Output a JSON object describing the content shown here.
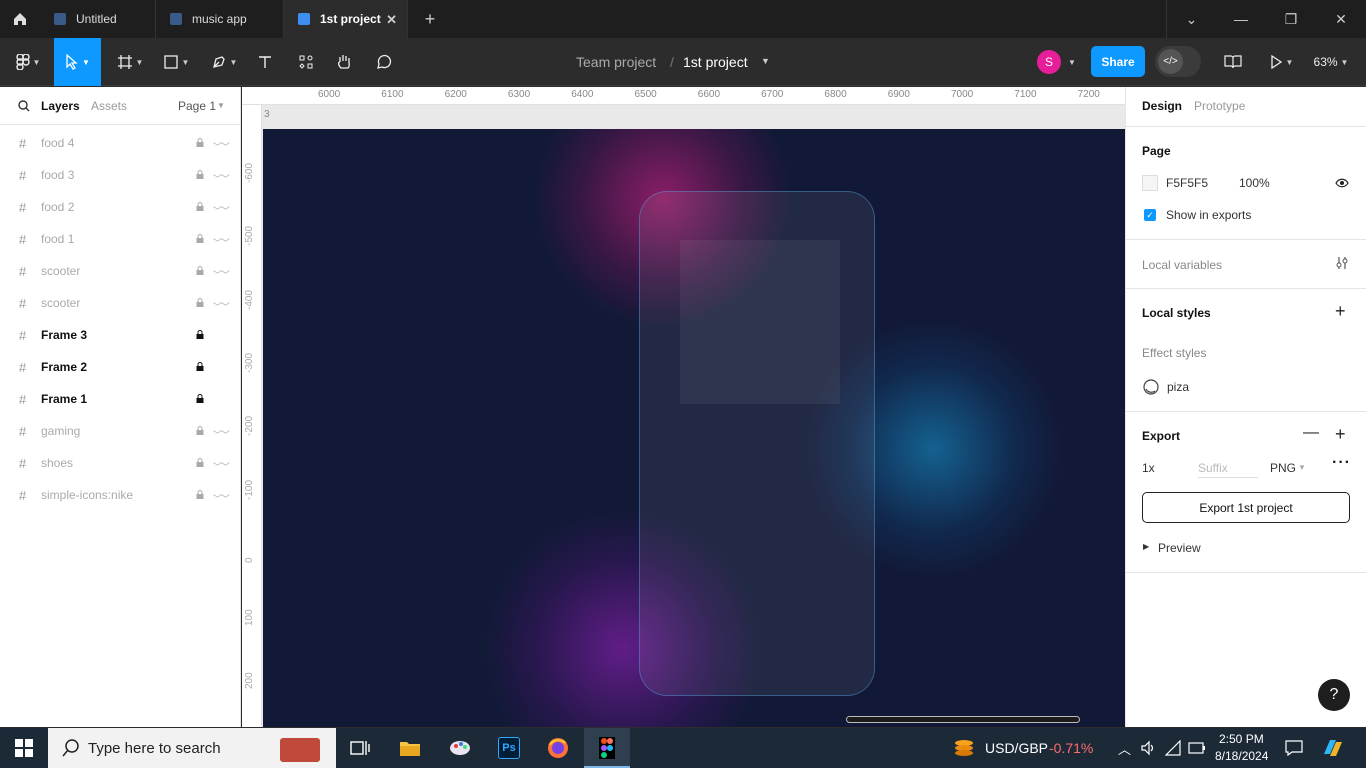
{
  "tabs": [
    {
      "label": "Untitled"
    },
    {
      "label": "music app"
    },
    {
      "label": "1st project"
    }
  ],
  "toolbar": {
    "team": "Team project",
    "separator": "/",
    "project": "1st project",
    "avatar_initial": "S",
    "share_label": "Share",
    "zoom": "63%"
  },
  "left_panel": {
    "tab_layers": "Layers",
    "tab_assets": "Assets",
    "page": "Page 1",
    "layers": [
      {
        "name": "food 4",
        "strong": false
      },
      {
        "name": "food 3",
        "strong": false
      },
      {
        "name": "food 2",
        "strong": false
      },
      {
        "name": "food 1",
        "strong": false
      },
      {
        "name": "scooter",
        "strong": false
      },
      {
        "name": "scooter",
        "strong": false
      },
      {
        "name": "Frame 3",
        "strong": true
      },
      {
        "name": "Frame 2",
        "strong": true
      },
      {
        "name": "Frame 1",
        "strong": true
      },
      {
        "name": "gaming",
        "strong": false
      },
      {
        "name": "shoes",
        "strong": false
      },
      {
        "name": "simple-icons:nike",
        "strong": false
      }
    ]
  },
  "canvas": {
    "ruler_top": [
      "6000",
      "6100",
      "6200",
      "6300",
      "6400",
      "6500",
      "6600",
      "6700",
      "6800",
      "6900",
      "7000",
      "7100",
      "7200"
    ],
    "ruler_left": [
      "-600",
      "-500",
      "-400",
      "-300",
      "-200",
      "-100",
      "0",
      "100",
      "200"
    ],
    "frame_label": "3",
    "frame_bg": "#121937"
  },
  "right_panel": {
    "tab_design": "Design",
    "tab_prototype": "Prototype",
    "page_title": "Page",
    "page_color": "F5F5F5",
    "page_opacity": "100%",
    "show_in_exports": "Show in exports",
    "local_variables": "Local variables",
    "local_styles": "Local styles",
    "effect_styles": "Effect styles",
    "effect_name": "piza",
    "export_title": "Export",
    "export_scale": "1x",
    "export_suffix_placeholder": "Suffix",
    "export_format": "PNG",
    "export_button": "Export 1st project",
    "preview": "Preview",
    "help": "?"
  },
  "taskbar": {
    "search_placeholder": "Type here to search",
    "ticker": "USD/GBP",
    "ticker_change": "-0.71%",
    "time": "2:50 PM",
    "date": "8/18/2024"
  },
  "colors": {
    "accent": "#0d99ff",
    "avatar": "#e61e9a",
    "ticker_negative": "#ff6b6b"
  }
}
